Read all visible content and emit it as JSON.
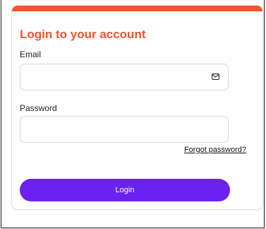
{
  "login": {
    "title": "Login to your account",
    "email_label": "Email",
    "email_value": "",
    "email_icon": "mail-icon",
    "password_label": "Password",
    "password_value": "",
    "forgot_link": "Forgot password?",
    "submit_label": "Login"
  },
  "colors": {
    "accent": "#f2542d",
    "primary_button": "#6b21f0",
    "text": "#1f1f1f",
    "border": "#d9d9d9"
  }
}
